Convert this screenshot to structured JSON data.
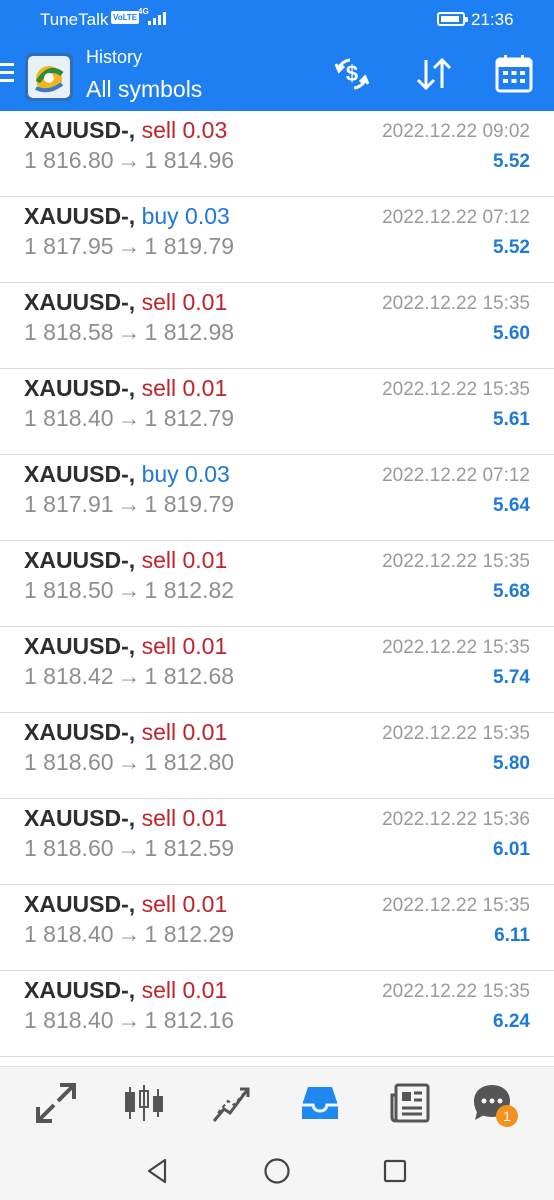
{
  "status_bar": {
    "carrier": "TuneTalk",
    "volte": "VoLTE",
    "network": "4G",
    "time": "21:36"
  },
  "app_bar": {
    "subtitle": "History",
    "title": "All symbols"
  },
  "trades": [
    {
      "symbol": "XAUUSD-,",
      "side": "sell",
      "volume": "0.03",
      "time": "2022.12.22 09:02",
      "open": "1 816.80",
      "close": "1 814.96",
      "profit": "5.52"
    },
    {
      "symbol": "XAUUSD-,",
      "side": "buy",
      "volume": "0.03",
      "time": "2022.12.22 07:12",
      "open": "1 817.95",
      "close": "1 819.79",
      "profit": "5.52"
    },
    {
      "symbol": "XAUUSD-,",
      "side": "sell",
      "volume": "0.01",
      "time": "2022.12.22 15:35",
      "open": "1 818.58",
      "close": "1 812.98",
      "profit": "5.60"
    },
    {
      "symbol": "XAUUSD-,",
      "side": "sell",
      "volume": "0.01",
      "time": "2022.12.22 15:35",
      "open": "1 818.40",
      "close": "1 812.79",
      "profit": "5.61"
    },
    {
      "symbol": "XAUUSD-,",
      "side": "buy",
      "volume": "0.03",
      "time": "2022.12.22 07:12",
      "open": "1 817.91",
      "close": "1 819.79",
      "profit": "5.64"
    },
    {
      "symbol": "XAUUSD-,",
      "side": "sell",
      "volume": "0.01",
      "time": "2022.12.22 15:35",
      "open": "1 818.50",
      "close": "1 812.82",
      "profit": "5.68"
    },
    {
      "symbol": "XAUUSD-,",
      "side": "sell",
      "volume": "0.01",
      "time": "2022.12.22 15:35",
      "open": "1 818.42",
      "close": "1 812.68",
      "profit": "5.74"
    },
    {
      "symbol": "XAUUSD-,",
      "side": "sell",
      "volume": "0.01",
      "time": "2022.12.22 15:35",
      "open": "1 818.60",
      "close": "1 812.80",
      "profit": "5.80"
    },
    {
      "symbol": "XAUUSD-,",
      "side": "sell",
      "volume": "0.01",
      "time": "2022.12.22 15:36",
      "open": "1 818.60",
      "close": "1 812.59",
      "profit": "6.01"
    },
    {
      "symbol": "XAUUSD-,",
      "side": "sell",
      "volume": "0.01",
      "time": "2022.12.22 15:35",
      "open": "1 818.40",
      "close": "1 812.29",
      "profit": "6.11"
    },
    {
      "symbol": "XAUUSD-,",
      "side": "sell",
      "volume": "0.01",
      "time": "2022.12.22 15:35",
      "open": "1 818.40",
      "close": "1 812.16",
      "profit": "6.24"
    }
  ],
  "arrow_glyph": "→",
  "bottom_nav": {
    "items": [
      "trade-icon",
      "chart-icon",
      "trade-signals-icon",
      "history-inbox-icon",
      "news-icon",
      "chat-icon"
    ],
    "active": "history-inbox-icon",
    "chat_badge": "1"
  },
  "colors": {
    "app_bar": "#1e7ff2",
    "sell": "#c0232b",
    "buy": "#1e78d6",
    "profit": "#1e7ad8",
    "nav_active": "#1e88f0",
    "nav_inactive": "#555555",
    "badge": "#f3921f"
  }
}
